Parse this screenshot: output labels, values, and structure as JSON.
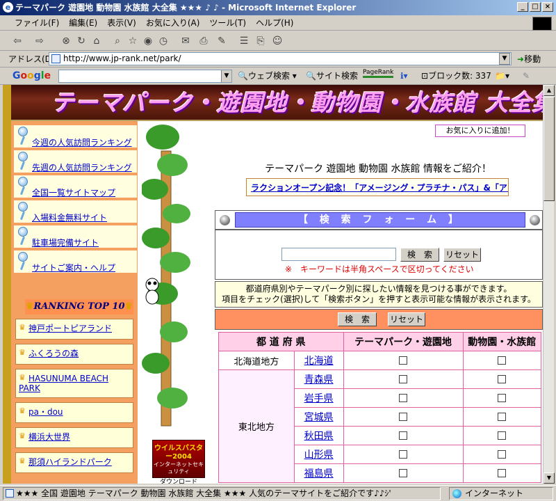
{
  "window": {
    "title": "テーマパーク 遊園地 動物園 水族館 大全集 ★★★ ♪ ♪ - Microsoft Internet Explorer",
    "controls": [
      "_",
      "□",
      "×"
    ]
  },
  "menu": [
    "ファイル(F)",
    "編集(E)",
    "表示(V)",
    "お気に入り(A)",
    "ツール(T)",
    "ヘルプ(H)"
  ],
  "address": {
    "label": "アドレス(D)",
    "url": "http://www.jp-rank.net/park/",
    "go": "移動"
  },
  "google_toolbar": {
    "logo": "Google",
    "web_search": "ウェブ検索",
    "site_search": "サイト検索",
    "pagerank": "PageRank",
    "popup_blocked": "ブロック数: 337"
  },
  "banner": {
    "title": "テーマパーク・遊園地・動物園・水族館 大全集！"
  },
  "sidenav": {
    "items": [
      "今週の人気訪問ランキング",
      "先週の人気訪問ランキング",
      "全国一覧サイトマップ",
      "入場料金無料サイト",
      "駐車場完備サイト",
      "サイトご案内・ヘルプ"
    ]
  },
  "ranking": {
    "title": "RANKING TOP 10",
    "items": [
      "神戸ポートピアランド",
      "ふくろうの森",
      "HASUNUMA BEACH PARK",
      "pa・dou",
      "横浜大世界",
      "那須ハイランドパーク"
    ]
  },
  "ad": {
    "title": "ウイルスバスター2004",
    "subtitle": "インターネットセキュリティ",
    "cta": "ダウンロード販売"
  },
  "main": {
    "favorite_button": "お気に入りに追加！",
    "intro": "テーマパーク 遊園地 動物園 水族館 情報をご紹介！",
    "news": "ラクションオープン記念！「アメージング・プラチナ・パス」&「ア:",
    "search_header": "【 検 索 フ ォ ー ム 】",
    "search_button": "検　索",
    "reset_button": "リセット",
    "keyword_value": "",
    "note": "※　キーワードは半角スペースで区切ってください",
    "info_line1": "都道府県別やテーマパーク別に探したい情報を見つける事ができます。",
    "info_line2": "項目をチェック(選択)して「検索ボタン」を押すと表示可能な情報が表示されます。",
    "search_button2": "検　索",
    "reset_button2": "リセット"
  },
  "table": {
    "headers": [
      "都 道 府 県",
      "テーマパーク・遊園地",
      "動物園・水族館"
    ],
    "region_hokkaido": "北海道地方",
    "region_tohoku": "東北地方",
    "prefectures": [
      "北海道",
      "青森県",
      "岩手県",
      "宮城県",
      "秋田県",
      "山形県",
      "福島県"
    ]
  },
  "status": {
    "text": "★★★ 全国 遊園地 テーマパーク 動物園 水族館 大全集 ★★★ 人気のテーマサイトをご紹介です♪♪ｼ'",
    "zone": "インターネット"
  }
}
